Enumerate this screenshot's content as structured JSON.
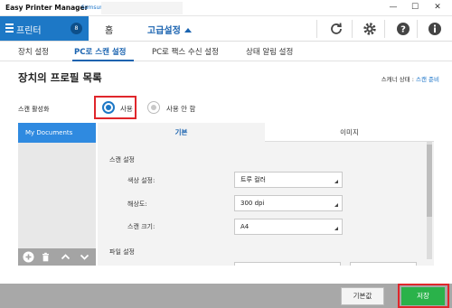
{
  "window": {
    "app_title": "Easy Printer Manager",
    "device_name": "Samsung C",
    "minimize": "—",
    "maximize": "☐",
    "close": "✕"
  },
  "toolbar": {
    "printer_label": "프린터",
    "printer_badge": "8",
    "home_label": "홈",
    "advanced_label": "고급설정"
  },
  "subtabs": [
    {
      "label": "장치 설정",
      "active": false
    },
    {
      "label": "PC로 스캔 설정",
      "active": true
    },
    {
      "label": "PC로 팩스 수신 설정",
      "active": false
    },
    {
      "label": "상태 알림 설정",
      "active": false
    }
  ],
  "page": {
    "title": "장치의 프로필 목록",
    "scanner_status_label": "스캐너 상태 :",
    "scanner_status_value": "스캔 준비"
  },
  "scan_toggle": {
    "label": "스캔 활성화",
    "option_on": "사용",
    "option_off": "사용 안 함",
    "selected": "사용"
  },
  "profiles": {
    "items": [
      "My Documents"
    ],
    "selected": "My Documents"
  },
  "detail_tabs": {
    "basic": "기본",
    "image": "이미지"
  },
  "scan_settings": {
    "section_title": "스캔 설정",
    "color_label": "색상 설정:",
    "color_value": "트루 컬러",
    "resolution_label": "해상도:",
    "resolution_value": "300 dpi",
    "size_label": "스캔 크기:",
    "size_value": "A4"
  },
  "file_settings": {
    "section_title": "파일 설정"
  },
  "footer": {
    "default_button": "기본값",
    "save_button": "저장"
  },
  "colors": {
    "accent": "#1d78c6",
    "highlight_box": "#e0262b",
    "save_green": "#2ab24a"
  }
}
